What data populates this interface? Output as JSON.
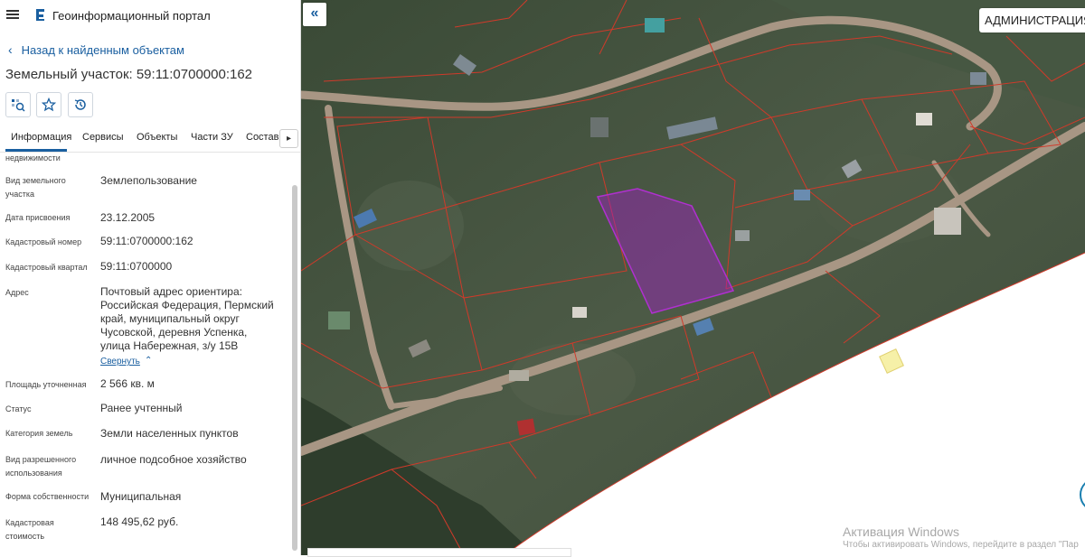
{
  "header": {
    "title": "Геоинформационный портал"
  },
  "nav": {
    "back_label": "Назад к найденным объектам"
  },
  "object": {
    "title": "Земельный участок: 59:11:0700000:162"
  },
  "tabs": [
    {
      "label": "Информация",
      "active": true
    },
    {
      "label": "Сервисы"
    },
    {
      "label": "Объекты"
    },
    {
      "label": "Части ЗУ"
    },
    {
      "label": "Состав"
    }
  ],
  "fields": {
    "partial_label": "недвижимости",
    "use_type": {
      "label": "Вид земельного участка",
      "value": "Землепользование"
    },
    "date": {
      "label": "Дата присвоения",
      "value": "23.12.2005"
    },
    "cad_number": {
      "label": "Кадастровый номер",
      "value": "59:11:0700000:162"
    },
    "cad_quarter": {
      "label": "Кадастровый квартал",
      "value": "59:11:0700000"
    },
    "address": {
      "label": "Адрес",
      "value": "Почтовый адрес ориентира: Российская Федерация, Пермский край, муниципальный округ Чусовской, деревня Успенка, улица Набережная, з/у 15В",
      "collapse_label": "Свернуть"
    },
    "area": {
      "label": "Площадь уточненная",
      "value": "2 566 кв. м"
    },
    "status": {
      "label": "Статус",
      "value": "Ранее учтенный"
    },
    "category": {
      "label": "Категория земель",
      "value": "Земли населенных пунктов"
    },
    "permitted_use": {
      "label": "Вид разрешенного использования",
      "value": "личное подсобное хозяйство"
    },
    "ownership": {
      "label": "Форма собственности",
      "value": "Муниципальная"
    },
    "cad_value": {
      "label": "Кадастровая стоимость",
      "value": "148 495,62 руб."
    }
  },
  "map": {
    "admin_label": "АДМИНИСТРАЦИЯ Ч",
    "highlight_color": "#a020c0",
    "parcel_line_color": "#d03a2a",
    "road_color": "#a89684"
  },
  "watermark": {
    "title": "Активация Windows",
    "text": "Чтобы активировать Windows, перейдите в раздел \"Пар"
  },
  "icons": [
    "menu-icon",
    "portal-logo-icon",
    "chevron-left-icon",
    "find-on-map-icon",
    "star-icon",
    "history-icon",
    "chevron-right-icon",
    "double-chevron-left-icon"
  ]
}
